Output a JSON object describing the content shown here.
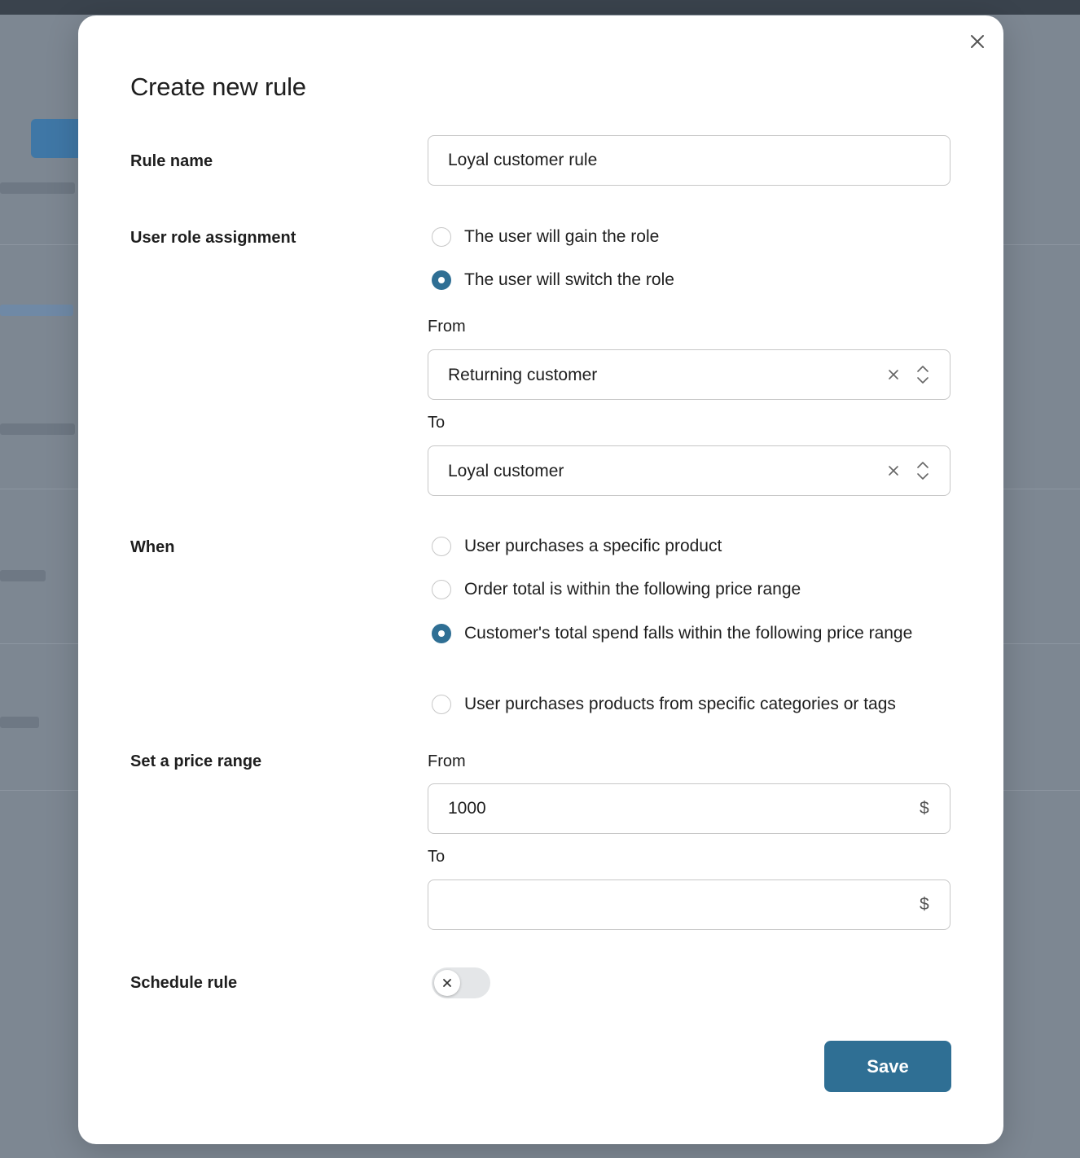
{
  "modal": {
    "title": "Create new rule",
    "close_icon": "close-icon"
  },
  "rule_name": {
    "label": "Rule name",
    "value": "Loyal customer rule"
  },
  "role_assignment": {
    "label": "User role assignment",
    "options": [
      {
        "label": "The user will gain the role",
        "checked": false
      },
      {
        "label": "The user will switch the role",
        "checked": true
      }
    ],
    "from_label": "From",
    "from_value": "Returning customer",
    "to_label": "To",
    "to_value": "Loyal customer"
  },
  "when": {
    "label": "When",
    "options": [
      {
        "label": "User purchases a specific product",
        "checked": false
      },
      {
        "label": "Order total is within the following price range",
        "checked": false
      },
      {
        "label": "Customer's total spend falls within the following price range",
        "checked": true
      },
      {
        "label": "User purchases products from specific categories or tags",
        "checked": false
      }
    ]
  },
  "price_range": {
    "label": "Set a price range",
    "from_label": "From",
    "from_value": "1000",
    "to_label": "To",
    "to_value": "",
    "currency": "$"
  },
  "schedule": {
    "label": "Schedule rule",
    "enabled": false
  },
  "actions": {
    "save_label": "Save"
  },
  "colors": {
    "accent": "#2f6f94",
    "border": "#c7c7c7",
    "overlay": "#7d8792"
  }
}
